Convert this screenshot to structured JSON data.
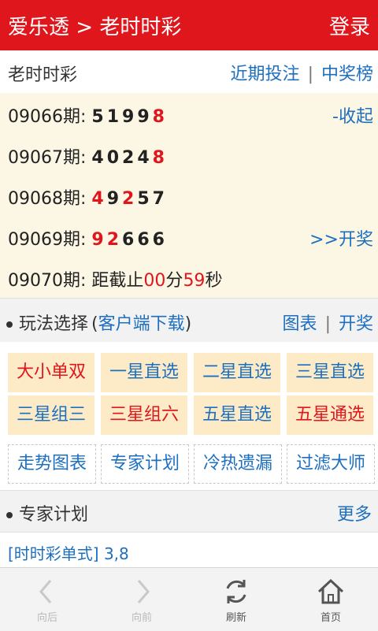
{
  "header": {
    "title": "爱乐透 > 老时时彩",
    "login": "登录"
  },
  "subbar": {
    "name": "老时时彩",
    "recent_bets": "近期投注",
    "separator": "|",
    "winners": "中奖榜"
  },
  "draws": [
    {
      "issue": "09066期:",
      "d": [
        "5",
        "1",
        "9",
        "9",
        "8"
      ],
      "right": "-收起"
    },
    {
      "issue": "09067期:",
      "d": [
        "4",
        "0",
        "2",
        "4",
        "8"
      ]
    },
    {
      "issue": "09068期:",
      "d": [
        "4",
        "9",
        "2",
        "5",
        "7"
      ]
    },
    {
      "issue": "09069期:",
      "d": [
        "9",
        "2",
        "6",
        "6",
        "6"
      ],
      "right": ">>开奖"
    }
  ],
  "countdown": {
    "issue": "09070期:",
    "prefix": "距截止",
    "minutes": "00",
    "min_unit": "分",
    "seconds": "59",
    "sec_unit": "秒"
  },
  "play": {
    "label": "玩法选择",
    "open": "(",
    "download": "客户端下载",
    "close": ")",
    "chart": "图表",
    "separator": "|",
    "draw": "开奖"
  },
  "grid": {
    "row1": [
      "大小单双",
      "一星直选",
      "二星直选",
      "三星直选"
    ],
    "row2": [
      "三星组三",
      "三星组六",
      "五星直选",
      "五星通选"
    ],
    "row3": [
      "走势图表",
      "专家计划",
      "冷热遗漏",
      "过滤大师"
    ]
  },
  "expert": {
    "label": "专家计划",
    "more": "更多",
    "line": "[时时彩单式] 3,8"
  },
  "bottom": {
    "back": "向后",
    "forward": "向前",
    "refresh": "刷新",
    "home": "首页"
  },
  "colors": {
    "header": "#e0161d",
    "link": "#1d6fbf",
    "highlight": "#e0161d",
    "cell_bg": "#fcebc6",
    "draws_bg": "#fcf6e4"
  }
}
